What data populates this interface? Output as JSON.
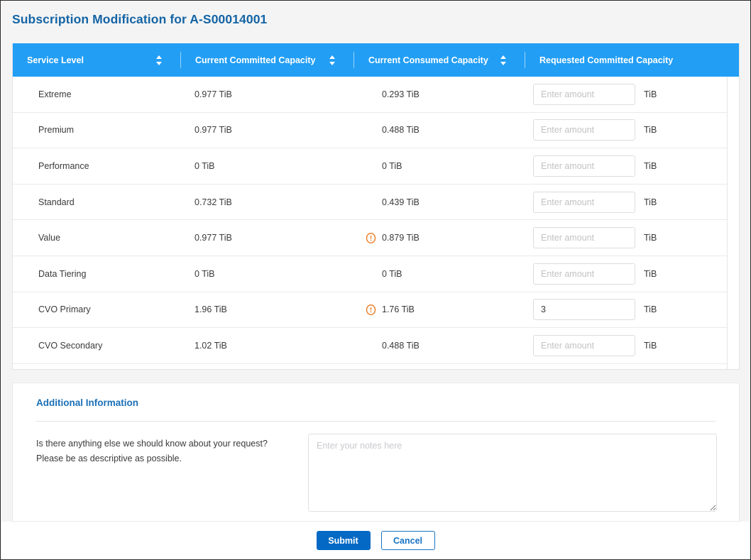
{
  "page": {
    "title": "Subscription Modification for A-S00014001",
    "accent_blue": "#1464a5",
    "header_blue": "#229ef5",
    "warning_orange": "#ed7b22"
  },
  "table": {
    "columns": [
      {
        "label": "Service Level",
        "sortable": true
      },
      {
        "label": "Current Committed Capacity",
        "sortable": true
      },
      {
        "label": "Current Consumed Capacity",
        "sortable": true
      },
      {
        "label": "Requested Committed Capacity",
        "sortable": false
      }
    ],
    "unit": "TiB",
    "input_placeholder": "Enter amount",
    "rows": [
      {
        "service_level": "Extreme",
        "current_committed": "0.977 TiB",
        "current_consumed": "0.293 TiB",
        "consumed_warning": false,
        "requested_value": ""
      },
      {
        "service_level": "Premium",
        "current_committed": "0.977 TiB",
        "current_consumed": "0.488 TiB",
        "consumed_warning": false,
        "requested_value": ""
      },
      {
        "service_level": "Performance",
        "current_committed": "0 TiB",
        "current_consumed": "0 TiB",
        "consumed_warning": false,
        "requested_value": ""
      },
      {
        "service_level": "Standard",
        "current_committed": "0.732 TiB",
        "current_consumed": "0.439 TiB",
        "consumed_warning": false,
        "requested_value": ""
      },
      {
        "service_level": "Value",
        "current_committed": "0.977 TiB",
        "current_consumed": "0.879 TiB",
        "consumed_warning": true,
        "requested_value": ""
      },
      {
        "service_level": "Data Tiering",
        "current_committed": "0 TiB",
        "current_consumed": "0 TiB",
        "consumed_warning": false,
        "requested_value": ""
      },
      {
        "service_level": "CVO Primary",
        "current_committed": "1.96 TiB",
        "current_consumed": "1.76 TiB",
        "consumed_warning": true,
        "requested_value": "3"
      },
      {
        "service_level": "CVO Secondary",
        "current_committed": "1.02 TiB",
        "current_consumed": "0.488 TiB",
        "consumed_warning": false,
        "requested_value": ""
      }
    ]
  },
  "additional_information": {
    "title": "Additional Information",
    "question_line_1": "Is there anything else we should know about your request?",
    "question_line_2": "Please be as descriptive as possible.",
    "notes_placeholder": "Enter your notes here",
    "notes_value": ""
  },
  "footer": {
    "submit_label": "Submit",
    "cancel_label": "Cancel"
  }
}
